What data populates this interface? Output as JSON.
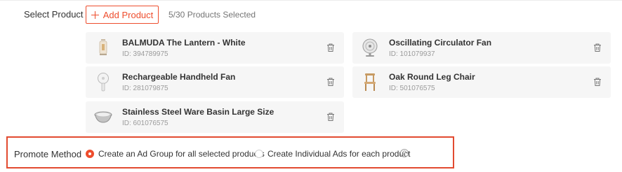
{
  "select_product": {
    "label": "Select Product",
    "add_button_label": "Add Product",
    "selected_count": "5/30 Products Selected"
  },
  "products": [
    {
      "name": "BALMUDA The Lantern - White",
      "id": "ID: 394789975",
      "icon": "lantern-icon"
    },
    {
      "name": "Oscillating Circulator Fan",
      "id": "ID: 101079937",
      "icon": "fan-icon"
    },
    {
      "name": "Rechargeable Handheld Fan",
      "id": "ID: 281079875",
      "icon": "handheld-fan-icon"
    },
    {
      "name": "Oak Round Leg Chair",
      "id": "ID: 501076575",
      "icon": "chair-icon"
    },
    {
      "name": "Stainless Steel Ware Basin Large Size",
      "id": "ID: 601076575",
      "icon": "basin-icon"
    }
  ],
  "promote": {
    "label": "Promote Method",
    "options": [
      {
        "label": "Create an Ad Group for all selected products",
        "selected": true
      },
      {
        "label": "Create Individual Ads for each product",
        "selected": false
      }
    ],
    "help_glyph": "?"
  },
  "colors": {
    "accent": "#ee4d2d",
    "highlight_border": "#e24b30",
    "card_bg": "#f6f6f6"
  }
}
